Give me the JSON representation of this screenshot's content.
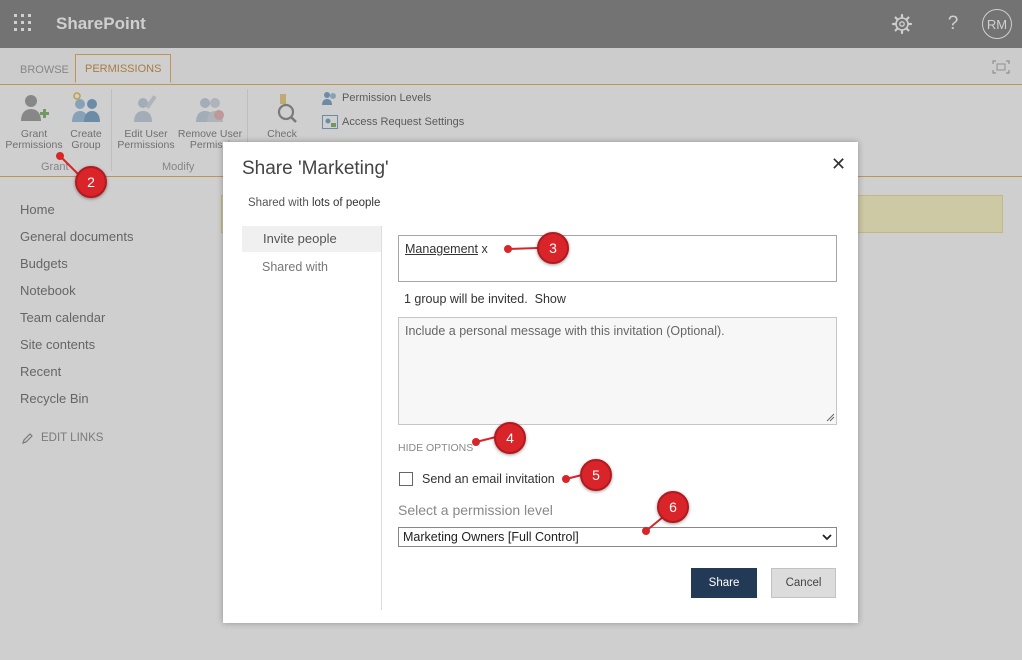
{
  "suitebar": {
    "app_name": "SharePoint",
    "avatar_initials": "RM",
    "help_glyph": "?"
  },
  "tabs": [
    {
      "label": "BROWSE"
    },
    {
      "label": "PERMISSIONS"
    }
  ],
  "ribbon": {
    "grant_permissions": [
      "Grant",
      "Permissions"
    ],
    "create_group": [
      "Create",
      "Group"
    ],
    "edit_user_permissions": [
      "Edit User",
      "Permissions"
    ],
    "remove_user_permissions": [
      "Remove User",
      "Permissi"
    ],
    "check_permissions": [
      "Check"
    ],
    "permission_levels": "Permission Levels",
    "access_request_settings": "Access Request Settings",
    "group_grant": "Grant",
    "group_modify": "Modify"
  },
  "leftnav": {
    "items": [
      "Home",
      "General documents",
      "Budgets",
      "Notebook",
      "Team calendar",
      "Site contents",
      "Recent",
      "Recycle Bin"
    ],
    "edit_links": "EDIT LINKS"
  },
  "dialog": {
    "title": "Share 'Marketing'",
    "close_glyph": "✕",
    "shared_with_prefix": "Shared with ",
    "shared_with_link": "lots of people",
    "side_tabs": [
      "Invite people",
      "Shared with"
    ],
    "invite_token": "Management",
    "token_remove": " x",
    "invite_info": "1 group will be invited.",
    "show_link": "Show",
    "message_placeholder": "Include a personal message with this invitation (Optional).",
    "hide_options": "HIDE OPTIONS",
    "send_email_label": "Send an email invitation",
    "permission_label": "Select a permission level",
    "permission_value": "Marketing Owners [Full Control]",
    "share_button": "Share",
    "cancel_button": "Cancel"
  },
  "callouts": [
    "2",
    "3",
    "4",
    "5",
    "6"
  ],
  "colors": {
    "accent": "#e3a33a",
    "share_button": "#233a56",
    "callout": "#d9242a",
    "suitebar": "#6b6b6b"
  }
}
